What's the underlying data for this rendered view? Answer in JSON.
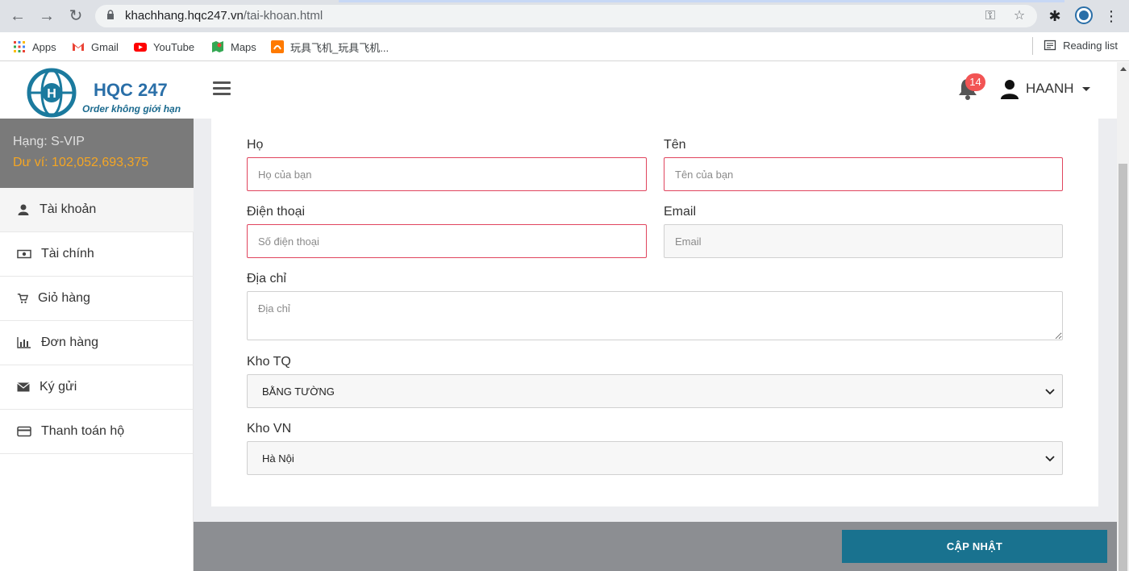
{
  "browser": {
    "url_domain": "khachhang.hqc247.vn",
    "url_path": "/tai-khoan.html",
    "bookmarks": [
      {
        "label": "Apps",
        "icon": "apps-grid-icon"
      },
      {
        "label": "Gmail",
        "icon": "gmail-icon"
      },
      {
        "label": "YouTube",
        "icon": "youtube-icon"
      },
      {
        "label": "Maps",
        "icon": "maps-icon"
      },
      {
        "label": "玩具飞机_玩具飞机...",
        "icon": "alibaba-icon"
      }
    ],
    "reading_list": "Reading list"
  },
  "header": {
    "logo_title": "HQC 247",
    "logo_subtitle": "Order không giới hạn",
    "notification_count": "14",
    "username": "HAANH"
  },
  "sidebar": {
    "rank": "Hạng: S-VIP",
    "balance": "Dư ví: 102,052,693,375",
    "items": [
      {
        "label": "Tài khoản",
        "icon": "user-icon"
      },
      {
        "label": "Tài chính",
        "icon": "money-icon"
      },
      {
        "label": "Giỏ hàng",
        "icon": "cart-icon"
      },
      {
        "label": "Đơn hàng",
        "icon": "bar-chart-icon"
      },
      {
        "label": "Ký gửi",
        "icon": "envelope-icon"
      },
      {
        "label": "Thanh toán hộ",
        "icon": "credit-card-icon"
      }
    ]
  },
  "form": {
    "last_name_label": "Họ",
    "last_name_placeholder": "Họ của bạn",
    "first_name_label": "Tên",
    "first_name_placeholder": "Tên của bạn",
    "phone_label": "Điện thoại",
    "phone_placeholder": "Số điện thoại",
    "email_label": "Email",
    "email_placeholder": "Email",
    "address_label": "Địa chỉ",
    "address_placeholder": "Địa chỉ",
    "warehouse_cn_label": "Kho TQ",
    "warehouse_cn_value": "BẰNG TƯỜNG",
    "warehouse_vn_label": "Kho VN",
    "warehouse_vn_value": "Hà Nội",
    "submit_label": "CẬP NHẬT"
  },
  "colors": {
    "accent": "#19728f",
    "balance": "#f5a623",
    "error_border": "#e0455e",
    "badge": "#f25454"
  }
}
